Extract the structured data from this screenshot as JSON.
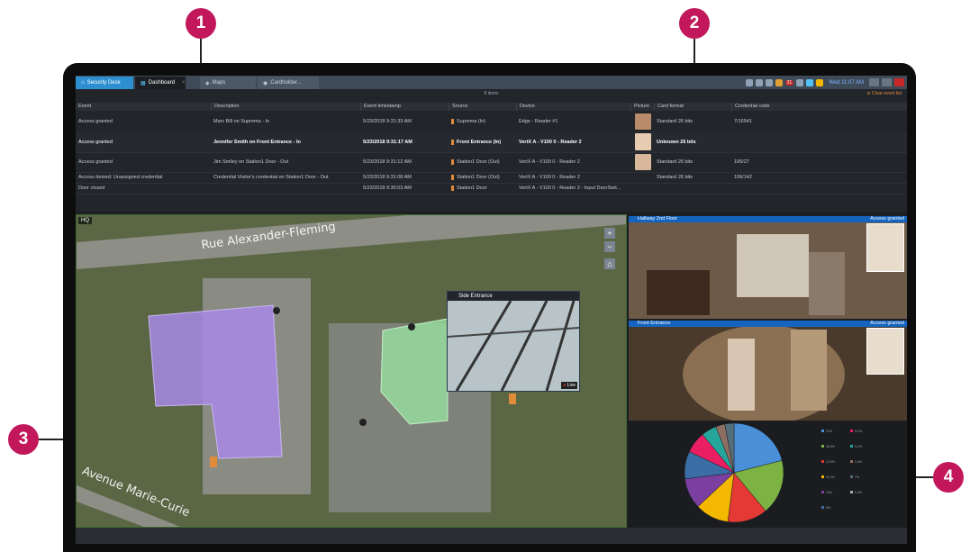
{
  "callouts": [
    "1",
    "2",
    "3",
    "4"
  ],
  "titlebar": {
    "tabs": [
      {
        "label": "Security Desk"
      },
      {
        "label": "Dashboard"
      },
      {
        "label": "Maps"
      },
      {
        "label": "Cardholder..."
      }
    ],
    "clock": "Wed 11:07 AM",
    "notification_count": "21"
  },
  "events": {
    "items_count": "8 items",
    "clear_label": "Clear event list",
    "columns": [
      "Event",
      "Description",
      "Event timestamp",
      "Source",
      "Device",
      "Picture",
      "Card format",
      "Credential code"
    ],
    "rows": [
      {
        "event": "Access granted",
        "description": "Marc Bill on Suprema - In",
        "timestamp": "5/23/2018 9:31:33 AM",
        "source": "Suprema (In)",
        "device": "Edge - Reader #1",
        "card_format": "Standard 26 bits",
        "credential": "7/16541"
      },
      {
        "event": "Access granted",
        "description": "Jennifer Smith on Front Entrance - In",
        "timestamp": "5/23/2018 9:31:17 AM",
        "source": "Front Entrance (In)",
        "device": "VertX A - V100 0 - Reader 2",
        "card_format": "Unknown 26 bits",
        "credential": ""
      },
      {
        "event": "Access granted",
        "description": "Jim Smiley on Station1 Door - Out",
        "timestamp": "5/23/2018 9:31:12 AM",
        "source": "Station1 Door (Out)",
        "device": "VertX A - V100 0 - Reader 2",
        "card_format": "Standard 26 bits",
        "credential": "106/27"
      },
      {
        "event": "Access denied: Unassigned credential",
        "description": "Credential Visitor's credential on Station1 Door - Out",
        "timestamp": "5/23/2018 9:31:08 AM",
        "source": "Station1 Door (Out)",
        "device": "VertX A - V100 0 - Reader 2",
        "card_format": "Standard 26 bits",
        "credential": "106/142"
      },
      {
        "event": "Door closed",
        "description": "",
        "timestamp": "5/23/2018 9:30:03 AM",
        "source": "Station1 Door",
        "device": "VertX A - V100 0 - Reader 2 - Input DoorSwit...",
        "card_format": "",
        "credential": ""
      }
    ]
  },
  "map": {
    "label": "HQ",
    "road_top": "Rue Alexander-Fleming",
    "road_bottom": "Avenue Marie-Curie",
    "zoom_in": "+",
    "zoom_out": "−",
    "home": "⌂",
    "overlay_camera": "Side Entrance",
    "live_label": "Live"
  },
  "video_tiles": [
    {
      "title": "Hallway 2nd Floor",
      "status": "Access granted"
    },
    {
      "title": "Front Entrance",
      "status": "Access granted"
    }
  ],
  "pie": {
    "slices": [
      {
        "value": 21,
        "color": "#4a90d9"
      },
      {
        "value": 18,
        "color": "#7cb342"
      },
      {
        "value": 13,
        "color": "#e53935"
      },
      {
        "value": 11,
        "color": "#f5b800"
      },
      {
        "value": 10,
        "color": "#7b3fa0"
      },
      {
        "value": 9,
        "color": "#3a6ea5"
      },
      {
        "value": 7,
        "color": "#e91e63"
      },
      {
        "value": 5,
        "color": "#26a69a"
      },
      {
        "value": 3,
        "color": "#8d6e63"
      },
      {
        "value": 3,
        "color": "#546e7a"
      }
    ],
    "legend": [
      {
        "label": "21%",
        "color": "#4a90d9"
      },
      {
        "label": "18.0%",
        "color": "#7cb342"
      },
      {
        "label": "13.0%",
        "color": "#e53935"
      },
      {
        "label": "11.2%",
        "color": "#f5b800"
      },
      {
        "label": "10%",
        "color": "#7b3fa0"
      },
      {
        "label": "9%",
        "color": "#3a6ea5"
      },
      {
        "label": "5.1%",
        "color": "#e91e63"
      },
      {
        "label": "3.2%",
        "color": "#26a69a"
      },
      {
        "label": "2.4%",
        "color": "#8d6e63"
      },
      {
        "label": "7%",
        "color": "#546e7a"
      },
      {
        "label": "5.4%",
        "color": "#aaaaaa"
      }
    ]
  },
  "colors": {
    "accent": "#c2185b",
    "tab_active": "#2d8fd0",
    "video_header": "#1565c0"
  }
}
